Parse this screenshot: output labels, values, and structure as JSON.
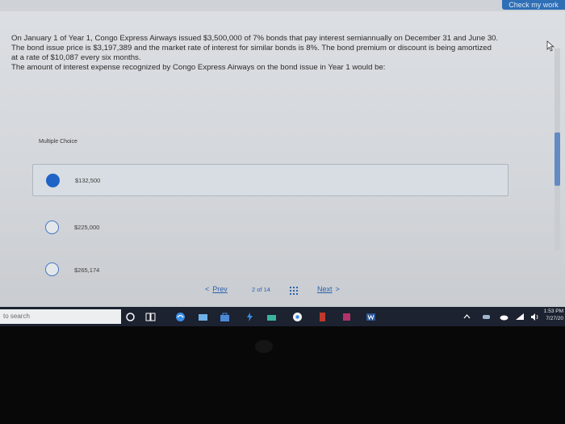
{
  "header": {
    "check_label": "Check my work"
  },
  "question": {
    "line1": "On January 1 of Year 1, Congo Express Airways issued $3,500,000 of 7% bonds that pay interest semiannually on December 31 and June 30.",
    "line2": "The bond issue price is $3,197,389 and the market rate of interest for similar bonds is 8%. The bond premium or discount is being amortized",
    "line3": "at a rate of $10,087 every six months.",
    "line4": "The amount of interest expense recognized by Congo Express Airways on the bond issue in Year 1 would be:"
  },
  "choices": {
    "label": "Multiple Choice",
    "options": [
      {
        "text": "$132,500",
        "selected": true
      },
      {
        "text": "$225,000",
        "selected": false
      },
      {
        "text": "$265,174",
        "selected": false
      }
    ]
  },
  "pager": {
    "prev_arrow": "<",
    "prev_label": "Prev",
    "page_count": "2 of 14",
    "next_label": "Next",
    "next_arrow": ">"
  },
  "taskbar": {
    "search_placeholder": "to search",
    "time": "1:53 PM",
    "date": "7/27/20"
  },
  "colors": {
    "accent": "#1f63c7",
    "link": "#2e61ae",
    "taskbar": "#1c2230"
  },
  "icons": [
    "cursor-icon",
    "grid-icon",
    "cortana-icon",
    "task-view-icon",
    "edge-icon",
    "store-icon",
    "word-icon",
    "wifi-icon",
    "volume-icon"
  ]
}
